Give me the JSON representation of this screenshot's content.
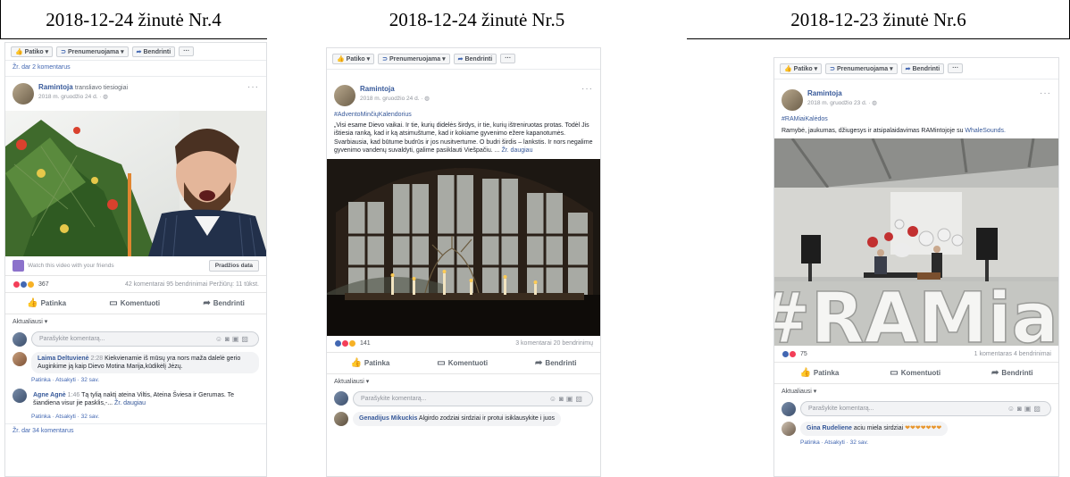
{
  "captions": [
    "2018-12-24 žinutė Nr.4",
    "2018-12-24 žinutė Nr.5",
    "2018-12-23 žinutė Nr.6"
  ],
  "toolbar": {
    "like": "Patiko",
    "follow": "Prenumeruojama",
    "share": "Bendrinti",
    "more": "···"
  },
  "colors": {
    "fb_blue": "#4267b2",
    "link": "#365899",
    "border": "#dddfe2"
  },
  "icons": [
    "like-icon",
    "rss-icon",
    "share-arrow-icon",
    "more-icon",
    "camera-icon",
    "gif-icon",
    "sticker-icon",
    "emoji-icon"
  ],
  "actions": {
    "like": "Patinka",
    "comment": "Komentuoti",
    "share": "Bendrinti"
  },
  "sort_label": "Aktualiausi ▾",
  "comment_placeholder": "Parašykite komentarą...",
  "p1": {
    "prev_comments": "Žr. dar 2 komentarus",
    "author": "Ramintoja",
    "action": "transliavo tiesiogiai",
    "date": "2018 m. gruodžio 24 d. · ",
    "watch_text": "Watch this video with your friends",
    "watch_button": "Pradžios data",
    "reaction_count": "367",
    "stats_right": "42 komentarai  95 bendrinimai  Peržiūrų: 11 tūkst.",
    "comments": [
      {
        "name": "Laima Deltuvienė",
        "time": "2:28",
        "text": "Kiekvienamie iš mūsų yra nors maža dalelė gerio Auginkime ją kaip Dievo Motina Marija,kūdikėlį Jėzų.",
        "meta": "Patinka · Atsakyti · 32 sav."
      },
      {
        "name": "Agne Agnė",
        "time": "1:46",
        "text": "Tą tylią naktį ateina Viltis, Ateina Šviesa ir Gerumas. Te šiandiena visur jie pasklis,-...",
        "more": "Žr. daugiau",
        "meta": "Patinka · Atsakyti · 32 sav."
      }
    ],
    "more_comments": "Žr. dar 34 komentarus"
  },
  "p2": {
    "author": "Ramintoja",
    "date": "2018 m. gruodžio 24 d. · ",
    "hashtag": "#AdventoMinčiųKalendorius",
    "text": "„Visi esame Dievo vaikai. Ir tie, kurių didelės širdys, ir tie, kurių ištreniruotas protas. Todėl Jis ištiesia ranką, kad ir ką atsimuštume, kad ir kokiame gyvenimo ežere kapanotumės. Svarbiausia, kad būtume budrūs ir jos nusitvertume. O budri širdis – lankstis. Ir nors negalime gyvenimo vandenų suvaldyti, galime pasiklauti Viešpačiu. ...",
    "see_more": "Žr. daugiau",
    "reaction_count": "141",
    "stats_right": "3 komentarai  20 bendrinimų",
    "comments": [
      {
        "name": "Genadijus Mikuckis",
        "text": "Algirdo zodziai sirdziai ir protui isiklausykite i juos"
      }
    ]
  },
  "p3": {
    "author": "Ramintoja",
    "date": "2018 m. gruodžio 23 d. · ",
    "hashtag": "#RAMiaiKalėdos",
    "text": "Ramybė, jaukumas, džiugesys ir atsipalaidavimas RAMintojoje su ",
    "text_link": "WhaleSounds.",
    "sign_text": "#RAMiai",
    "reaction_count": "75",
    "stats_right": "1 komentaras  4 bendrinimai",
    "comments": [
      {
        "name": "Gina Rudeliene",
        "text": "aciu miela sirdziai",
        "meta": "Patinka · Atsakyti · 32 sav."
      }
    ]
  }
}
